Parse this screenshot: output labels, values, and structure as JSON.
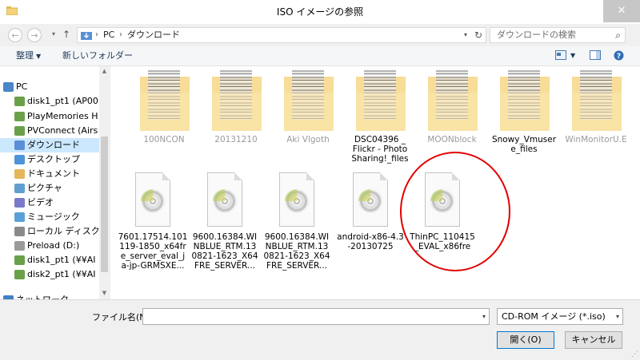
{
  "window": {
    "title": "ISO イメージの参照",
    "close_glyph": "✕"
  },
  "nav": {
    "back_glyph": "←",
    "forward_glyph": "→",
    "dropdown_glyph": "▾",
    "up_glyph": "↑",
    "breadcrumb": [
      "PC",
      "ダウンロード"
    ],
    "breadcrumb_sep": "›",
    "address_dropdown_glyph": "▾",
    "refresh_glyph": "↻",
    "search_placeholder": "ダウンロードの検索",
    "search_glyph": "⌕"
  },
  "toolbar": {
    "organize_label": "整理",
    "organize_caret": "▼",
    "new_folder_label": "新しいフォルダー",
    "view_caret": "▼",
    "help_glyph": "?"
  },
  "sidebar": {
    "scroll_up_glyph": "▲",
    "scroll_down_glyph": "▼",
    "items": [
      {
        "label": "PC",
        "icon": "computer-icon"
      },
      {
        "label": "disk1_pt1 (AP00",
        "icon": "network-drive-icon"
      },
      {
        "label": "PlayMemories H",
        "icon": "network-drive-icon"
      },
      {
        "label": "PVConnect (Airs",
        "icon": "network-drive-icon"
      },
      {
        "label": "ダウンロード",
        "icon": "downloads-folder-icon",
        "selected": true
      },
      {
        "label": "デスクトップ",
        "icon": "desktop-folder-icon"
      },
      {
        "label": "ドキュメント",
        "icon": "documents-folder-icon"
      },
      {
        "label": "ピクチャ",
        "icon": "pictures-folder-icon"
      },
      {
        "label": "ビデオ",
        "icon": "videos-folder-icon"
      },
      {
        "label": "ミュージック",
        "icon": "music-folder-icon"
      },
      {
        "label": "ローカル ディスク (C",
        "icon": "local-disk-icon"
      },
      {
        "label": "Preload (D:)",
        "icon": "drive-icon"
      },
      {
        "label": "disk1_pt1 (¥¥AI",
        "icon": "network-drive-icon"
      },
      {
        "label": "disk2_pt1 (¥¥AI",
        "icon": "network-drive-icon"
      },
      {
        "label": "ネットワーク",
        "icon": "network-icon"
      }
    ]
  },
  "files": {
    "folders": [
      {
        "label": "100NCON",
        "faded": true
      },
      {
        "label": "20131210",
        "faded": true
      },
      {
        "label": "Aki Vlgoth",
        "faded": true
      },
      {
        "label": "DSC04396 _\nFlickr - Photo\nSharing!_files",
        "faded": false
      },
      {
        "label": "MOONblock",
        "faded": true
      },
      {
        "label": "Snowy_Vmuser\ne_files",
        "faded": false
      },
      {
        "label": "WinMonitorU.E",
        "faded": true
      }
    ],
    "isos": [
      {
        "label": "7601.17514.101\n119-1850_x64fr\ne_server_eval_j\na-jp-GRMSXE..."
      },
      {
        "label": "9600.16384.WI\nNBLUE_RTM.13\n0821-1623_X64\nFRE_SERVER..."
      },
      {
        "label": "9600.16384.WI\nNBLUE_RTM.13\n0821-1623_X64\nFRE_SERVER..."
      },
      {
        "label": "android-x86-4.3\n-20130725"
      },
      {
        "label": "ThinPC_110415\n_EVAL_x86fre"
      }
    ]
  },
  "bottom": {
    "filename_label": "ファイル名(N):",
    "filename_value": "",
    "filename_caret": "▾",
    "filter_value": "CD-ROM イメージ (*.iso)",
    "filter_caret": "▾",
    "open_label": "開く(O)",
    "cancel_label": "キャンセル"
  },
  "colors": {
    "selection": "#cce8ff",
    "annotation_circle": "#e10000",
    "folder": "#f7dd98"
  }
}
